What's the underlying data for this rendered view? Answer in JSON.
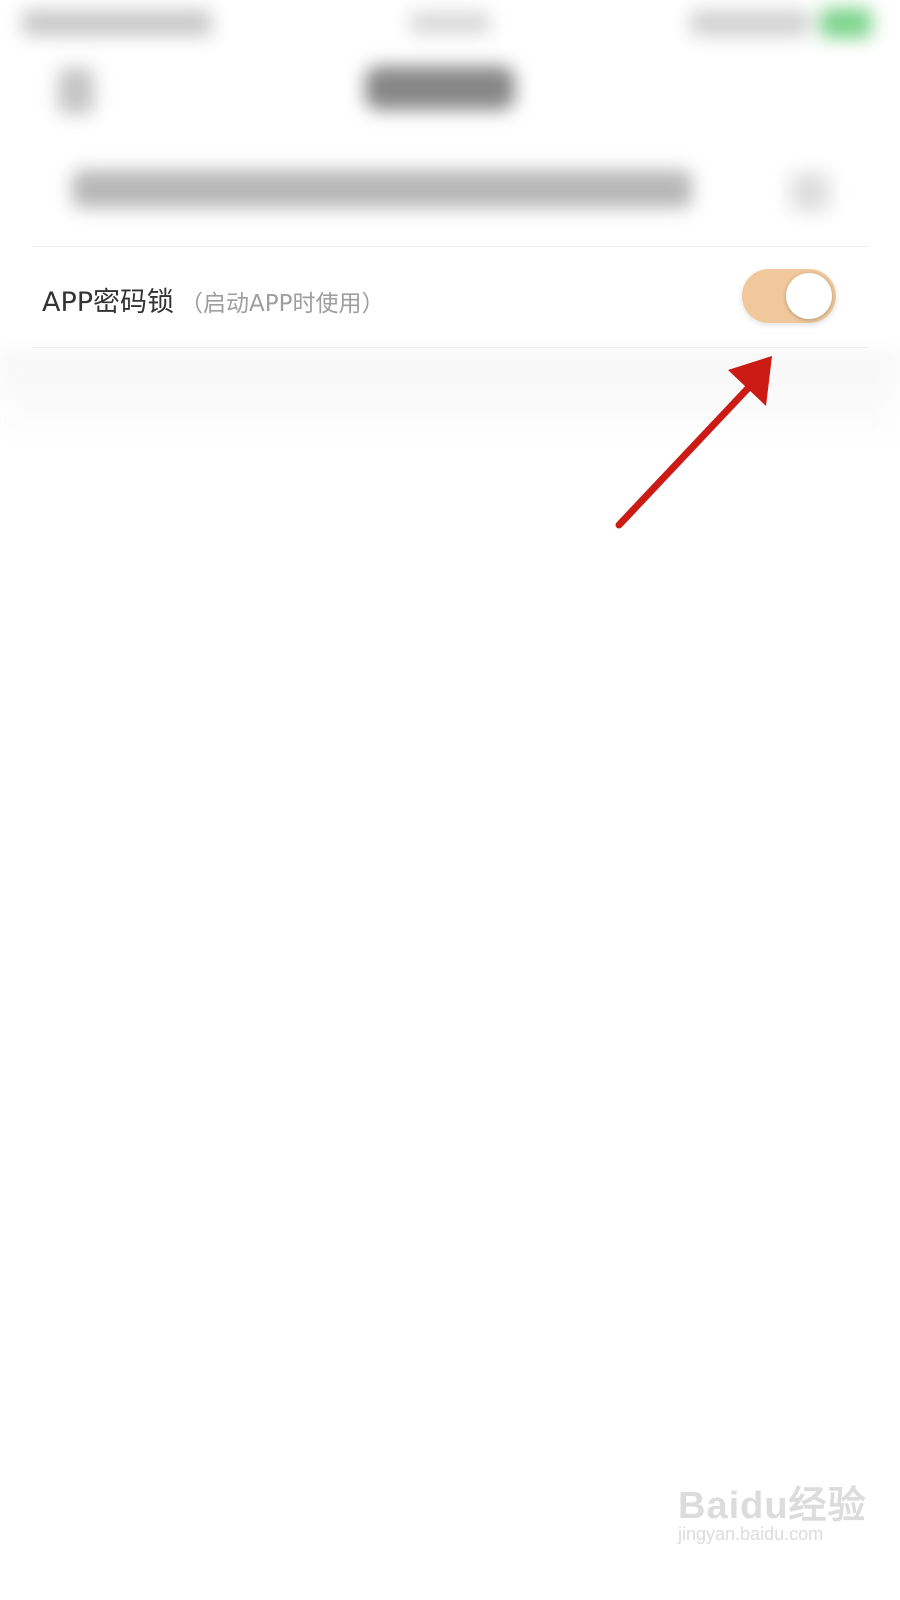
{
  "setting": {
    "label": "APP密码锁",
    "hint": "（启动APP时使用）",
    "toggle_on": true,
    "toggle_color": "#f0c89c"
  },
  "annotation": {
    "arrow_color": "#cc1a14"
  },
  "watermark": {
    "brand": "Baidu经验",
    "url": "jingyan.baidu.com"
  }
}
